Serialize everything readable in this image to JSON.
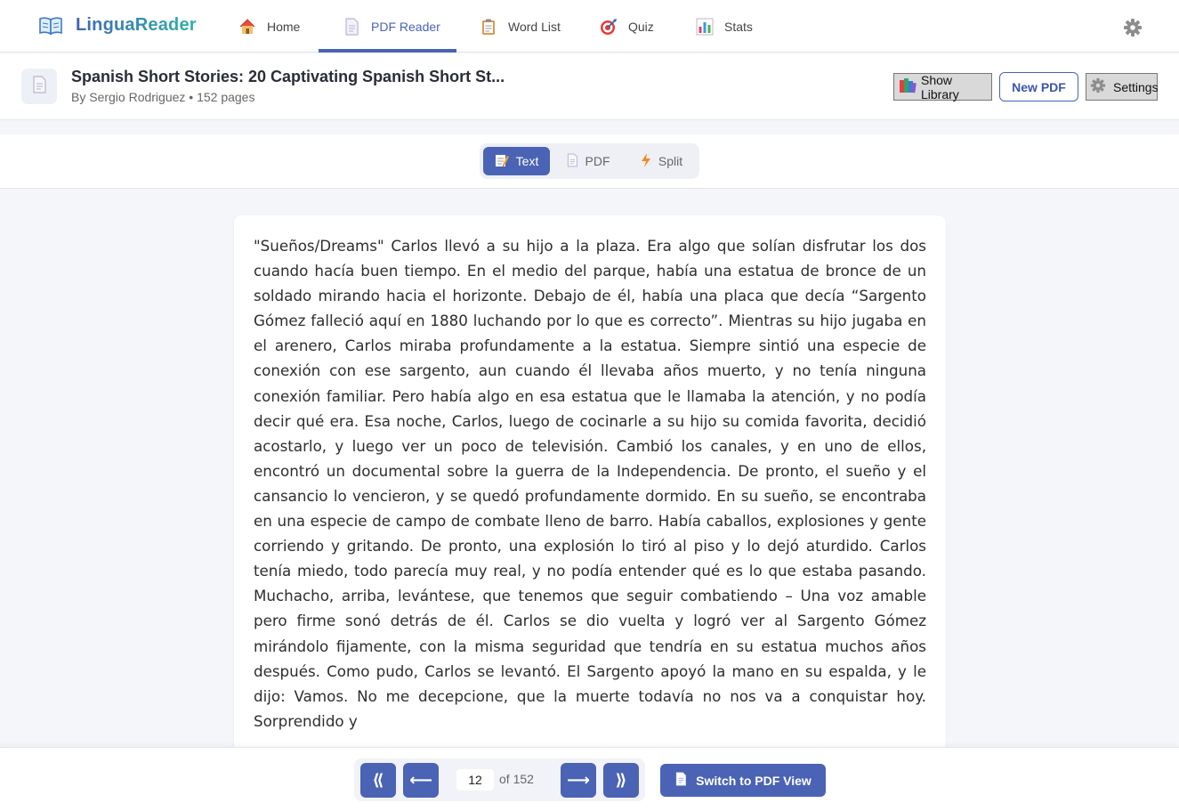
{
  "app": {
    "name": "LinguaReader"
  },
  "nav": {
    "items": [
      {
        "label": "Home",
        "icon": "house-icon"
      },
      {
        "label": "PDF Reader",
        "icon": "document-icon",
        "active": true
      },
      {
        "label": "Word List",
        "icon": "clipboard-icon"
      },
      {
        "label": "Quiz",
        "icon": "target-icon"
      },
      {
        "label": "Stats",
        "icon": "bar-chart-icon"
      }
    ],
    "settings_icon": "gear-icon"
  },
  "document": {
    "title": "Spanish Short Stories: 20 Captivating Spanish Short St...",
    "meta": "By Sergio Rodriguez • 152 pages",
    "actions": {
      "show_library": "Show Library",
      "new_pdf": "New PDF",
      "settings": "Settings"
    }
  },
  "view_modes": [
    {
      "label": "Text",
      "icon": "memo-icon",
      "active": true
    },
    {
      "label": "PDF",
      "icon": "document-icon",
      "active": false
    },
    {
      "label": "Split",
      "icon": "lightning-icon",
      "active": false
    }
  ],
  "reading_text": "\"Sueños/Dreams\"  Carlos llevó a su hijo a la plaza. Era algo que solían disfrutar los dos cuando hacía buen tiempo. En el medio del parque, había una estatua de bronce de un soldado mirando hacia el horizonte. Debajo de él, había una placa que decía “Sargento Gómez falleció aquí en 1880 luchando por lo que es correcto”. Mientras su hijo jugaba en el arenero, Carlos miraba profundamente a la estatua. Siempre sintió una especie de conexión con ese sargento, aun cuando él llevaba años muerto, y no tenía ninguna conexión familiar. Pero había algo en esa estatua que le llamaba la atención, y no podía decir qué era. Esa noche, Carlos, luego de cocinarle a su hijo su comida favorita, decidió acostarlo, y luego ver un poco de televisión. Cambió los canales, y en  uno  de  ellos,  encontró  un documental  sobre  la  guerra  de  la Independencia. De pronto, el sueño y el cansancio lo vencieron, y se quedó profundamente dormido. En su sueño, se encontraba en una especie de campo de combate lleno de barro. Había caballos, explosiones y gente corriendo y gritando. De pronto, una explosión lo tiró al piso y lo dejó aturdido. Carlos tenía miedo, todo parecía muy real, y no podía entender qué es lo que estaba pasando. Muchacho, arriba, levántese, que tenemos que seguir combatiendo – Una voz amable pero firme sonó detrás de él. Carlos  se  dio vuelta  y  logró  ver  al  Sargento  Gómez  mirándolo fijamente, con la misma seguridad que tendría en su estatua muchos años después. Como pudo, Carlos se levantó. El Sargento apoyó la mano en su espalda, y le dijo: Vamos. No me decepcione, que la muerte todavía no nos va a conquistar hoy. Sorprendido y",
  "pagination": {
    "first": "⟪",
    "prev": "⟵",
    "next": "⟶",
    "last": "⟫",
    "current_page": "12",
    "of_label": "of 152",
    "switch_label": "Switch to PDF View"
  }
}
